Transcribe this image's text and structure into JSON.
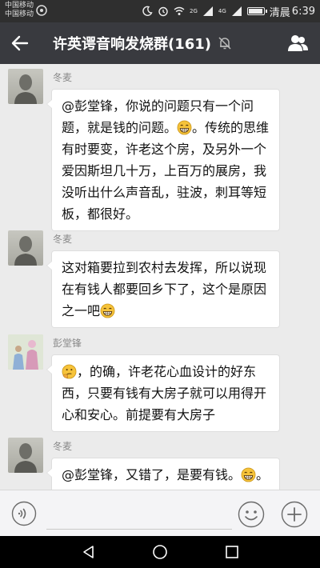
{
  "status_bar": {
    "carrier_1": "中国移动",
    "carrier_2": "中国移动",
    "network_1": "2G",
    "network_2": "4G",
    "carrier_name": "清晨",
    "time": "6:39",
    "battery_level": 0.85
  },
  "header": {
    "title": "许英谔音响发烧群(161)",
    "muted": true
  },
  "messages": [
    {
      "sender": "冬麦",
      "avatar": "grayscale-portrait",
      "segments": [
        {
          "type": "text",
          "value": "@彭堂锋，你说的问题只有一个问题，就是钱的问题。"
        },
        {
          "type": "emoji",
          "name": "grin-emoji"
        },
        {
          "type": "text",
          "value": "。传统的思维有时要变，许老这个房，及另外一个爱因斯坦几十万，上百万的展房，我没听出什么声音乱，驻波，刺耳等短板，都很好。"
        }
      ]
    },
    {
      "sender": "冬麦",
      "avatar": "grayscale-portrait",
      "segments": [
        {
          "type": "text",
          "value": "这对箱要拉到农村去发挥，所以说现在有钱人都要回乡下了，这个是原因之一吧"
        },
        {
          "type": "emoji",
          "name": "grin-emoji"
        }
      ]
    },
    {
      "sender": "彭堂锋",
      "avatar": "color-photo",
      "segments": [
        {
          "type": "emoji",
          "name": "thinking-emoji"
        },
        {
          "type": "text",
          "value": "，的确，许老花心血设计的好东西，只要有钱有大房子就可以用得开心和安心。前提要有大房子"
        }
      ]
    },
    {
      "sender": "冬麦",
      "avatar": "grayscale-portrait",
      "segments": [
        {
          "type": "text",
          "value": "@彭堂锋，又错了，是要有钱。"
        },
        {
          "type": "emoji",
          "name": "grin-emoji"
        },
        {
          "type": "text",
          "value": "。你在展会听了吗？"
        }
      ]
    }
  ],
  "input_bar": {
    "text_value": "",
    "voice_icon": "voice-icon",
    "emoji_icon": "emoji-icon",
    "more_icon": "plus-icon"
  },
  "nav_bar": {
    "back_icon": "back-triangle-icon",
    "home_icon": "home-circle-icon",
    "recent_icon": "recent-square-icon"
  },
  "colors": {
    "title_bar": "#393a3f",
    "status_bar": "#2f2f2f",
    "chat_background": "#ebebeb",
    "bubble": "#ffffff",
    "emoji_yellow": "#f6c33a"
  }
}
